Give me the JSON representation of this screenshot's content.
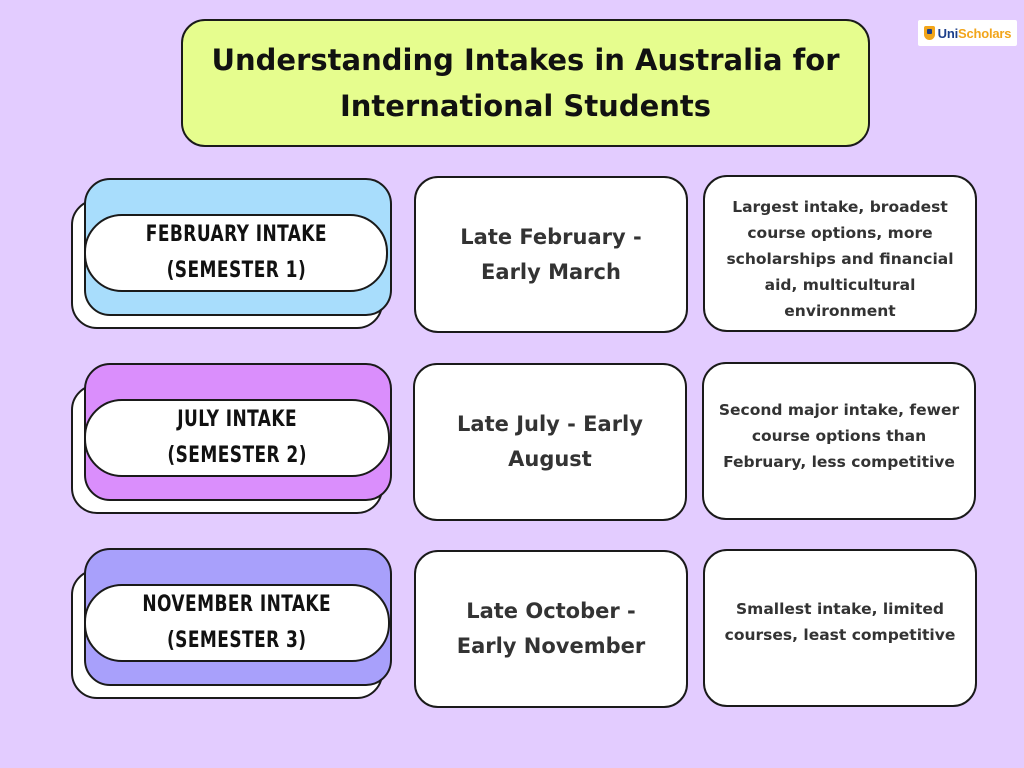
{
  "title": "Understanding Intakes in Australia for International Students",
  "logo": {
    "uni": "Uni",
    "scholars": "Scholars"
  },
  "colors": {
    "background": "#e3ccff",
    "title_bg": "#e6fd8e",
    "february": "#a8ddfc",
    "july": "#da8efc",
    "november": "#a8a0fb"
  },
  "intakes": [
    {
      "label_line1": "February Intake",
      "label_line2": "(Semester 1)",
      "dates": "Late February - Early March",
      "description": "Largest intake, broadest course options, more scholarships and financial aid, multicultural environment"
    },
    {
      "label_line1": "July Intake",
      "label_line2": "(Semester 2)",
      "dates": "Late July - Early August",
      "description": "Second major intake, fewer course options than February, less competitive"
    },
    {
      "label_line1": "November Intake",
      "label_line2": "(Semester 3)",
      "dates": "Late October - Early November",
      "description": "Smallest intake, limited courses, least competitive"
    }
  ]
}
